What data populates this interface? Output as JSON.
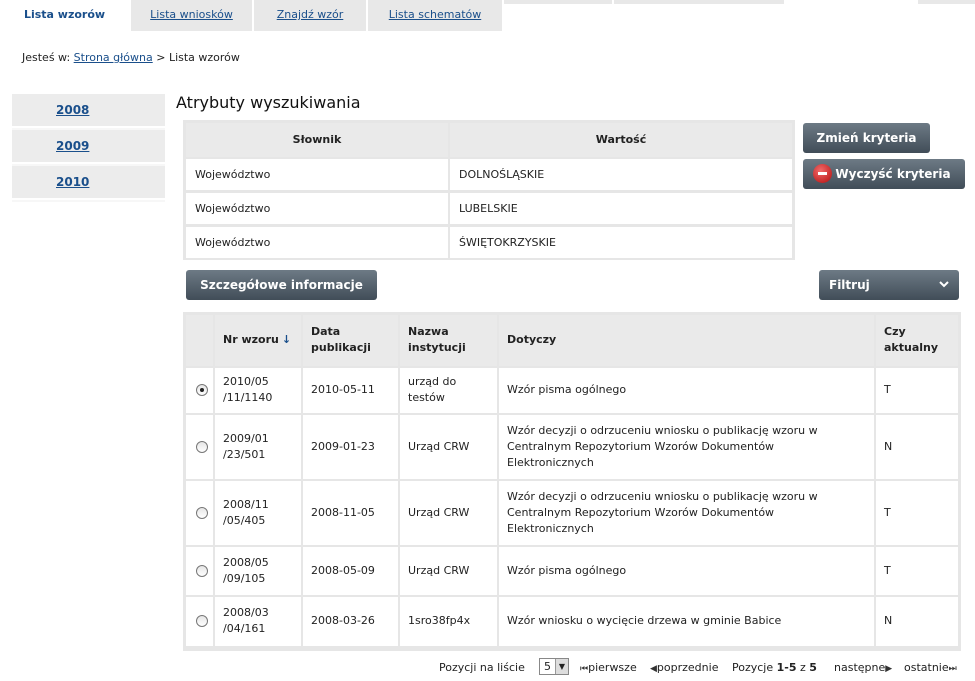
{
  "tabs": [
    {
      "label": "Lista wzorów",
      "active": true
    },
    {
      "label": "Lista wniosków",
      "active": false
    },
    {
      "label": "Znajdź wzór",
      "active": false
    },
    {
      "label": "Lista schematów",
      "active": false
    }
  ],
  "breadcrumb": {
    "prefix": "Jesteś w:",
    "home": "Strona główna",
    "separator": ">",
    "current": "Lista wzorów"
  },
  "years": [
    "2008",
    "2009",
    "2010"
  ],
  "search": {
    "heading": "Atrybuty wyszukiwania",
    "columns": {
      "dictionary": "Słownik",
      "value": "Wartość"
    },
    "rows": [
      {
        "dictionary": "Województwo",
        "value": "DOLNOŚLĄSKIE"
      },
      {
        "dictionary": "Województwo",
        "value": "LUBELSKIE"
      },
      {
        "dictionary": "Województwo",
        "value": "ŚWIĘTOKRZYSKIE"
      }
    ],
    "change_label": "Zmień kryteria",
    "clear_label": "Wyczyść kryteria"
  },
  "details_label": "Szczegółowe informacje",
  "filter_label": "Filtruj",
  "results": {
    "columns": {
      "number": "Nr wzoru",
      "sort_glyph": "↓",
      "date": "Data publikacji",
      "institution": "Nazwa instytucji",
      "concerns": "Dotyczy",
      "current": "Czy aktualny"
    },
    "rows": [
      {
        "number": "2010/05 /11/1140",
        "date": "2010-05-11",
        "institution": "urząd do testów",
        "concerns": "Wzór pisma ogólnego",
        "current": "T",
        "selected": true
      },
      {
        "number": "2009/01 /23/501",
        "date": "2009-01-23",
        "institution": "Urząd CRW",
        "concerns": "Wzór decyzji o odrzuceniu wniosku o publikację wzoru w Centralnym Repozytorium Wzorów Dokumentów Elektronicznych",
        "current": "N",
        "selected": false
      },
      {
        "number": "2008/11 /05/405",
        "date": "2008-11-05",
        "institution": "Urząd CRW",
        "concerns": "Wzór decyzji o odrzuceniu wniosku o publikację wzoru w Centralnym Repozytorium Wzorów Dokumentów Elektronicznych",
        "current": "T",
        "selected": false
      },
      {
        "number": "2008/05 /09/105",
        "date": "2008-05-09",
        "institution": "Urząd CRW",
        "concerns": "Wzór pisma ogólnego",
        "current": "T",
        "selected": false
      },
      {
        "number": "2008/03 /04/161",
        "date": "2008-03-26",
        "institution": "1sro38fp4x",
        "concerns": "Wzór wniosku o wycięcie drzewa w gminie Babice",
        "current": "N",
        "selected": false
      }
    ]
  },
  "pagination": {
    "per_page_label": "Pozycji na liście",
    "per_page_value": "5",
    "first_label": "pierwsze",
    "prev_label": "poprzednie",
    "positions_label": "Pozycje",
    "range": "1-5",
    "of_label": "z",
    "total": "5",
    "next_label": "następne",
    "last_label": "ostatnie"
  },
  "colors": {
    "accent": "#1a4f8b",
    "button_dark": "#4b5762",
    "clear_icon": "#c0171a"
  }
}
